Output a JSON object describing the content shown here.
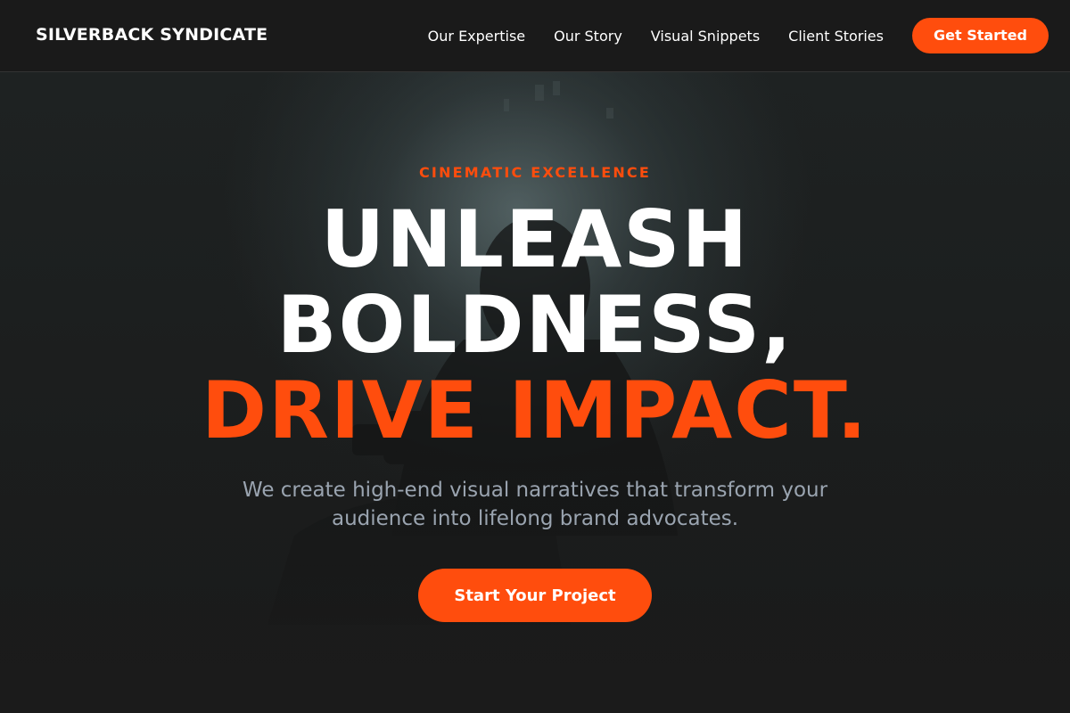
{
  "header": {
    "brand": "SILVERBACK SYNDICATE",
    "nav": [
      {
        "label": "Our Expertise"
      },
      {
        "label": "Our Story"
      },
      {
        "label": "Visual Snippets"
      },
      {
        "label": "Client Stories"
      }
    ],
    "cta_label": "Get Started"
  },
  "hero": {
    "eyebrow": "CINEMATIC EXCELLENCE",
    "headline_line1": "UNLEASH",
    "headline_line2": "BOLDNESS,",
    "headline_line3": "DRIVE IMPACT.",
    "subhead": "We create high-end visual narratives that transform your audience into lifelong brand advocates.",
    "cta_label": "Start Your Project",
    "background_icon": "filmmaker-silhouette-photo"
  },
  "colors": {
    "accent": "#ff4d0d",
    "background": "#1a1a1a",
    "text": "#ffffff",
    "muted_text": "#9aa4b0"
  }
}
